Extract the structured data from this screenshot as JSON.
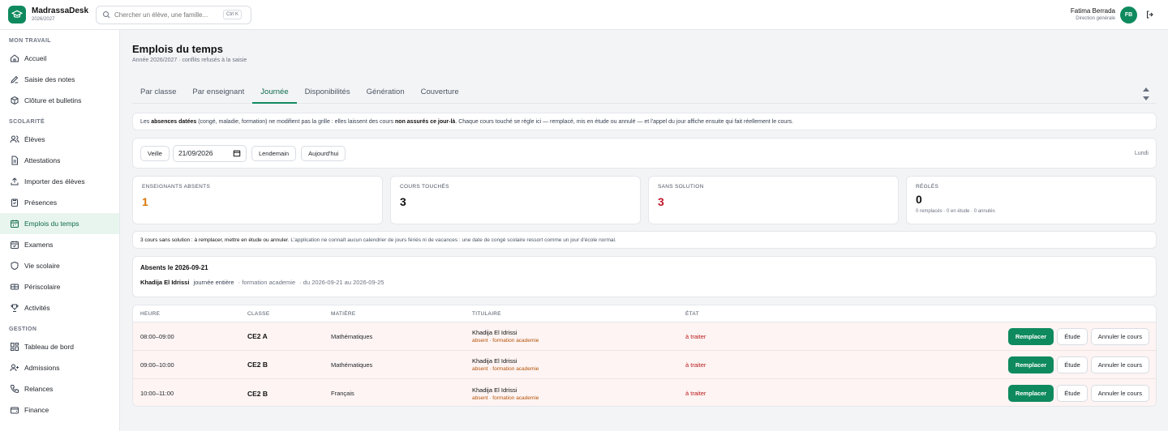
{
  "app": {
    "name": "MadrassaDesk",
    "year": "2026/2027"
  },
  "search": {
    "placeholder": "Chercher un élève, une famille...",
    "shortcut": "Ctrl K"
  },
  "user": {
    "name": "Fatima Berrada",
    "role": "Direction générale",
    "initials": "FB"
  },
  "sidebar": {
    "sections": [
      {
        "label": "MON TRAVAIL",
        "items": [
          {
            "label": "Accueil",
            "icon": "home-icon"
          },
          {
            "label": "Saisie des notes",
            "icon": "pen-icon"
          },
          {
            "label": "Clôture et bulletins",
            "icon": "box-icon"
          }
        ]
      },
      {
        "label": "SCOLARITÉ",
        "items": [
          {
            "label": "Élèves",
            "icon": "users-icon"
          },
          {
            "label": "Attestations",
            "icon": "file-icon"
          },
          {
            "label": "Importer des élèves",
            "icon": "upload-icon"
          },
          {
            "label": "Présences",
            "icon": "clipboard-icon"
          },
          {
            "label": "Emplois du temps",
            "icon": "calendar-icon",
            "active": true
          },
          {
            "label": "Examens",
            "icon": "exam-icon"
          },
          {
            "label": "Vie scolaire",
            "icon": "shield-icon"
          },
          {
            "label": "Périscolaire",
            "icon": "ticket-icon"
          },
          {
            "label": "Activités",
            "icon": "trophy-icon"
          }
        ]
      },
      {
        "label": "GESTION",
        "items": [
          {
            "label": "Tableau de bord",
            "icon": "dashboard-icon"
          },
          {
            "label": "Admissions",
            "icon": "user-plus-icon"
          },
          {
            "label": "Relances",
            "icon": "phone-icon"
          },
          {
            "label": "Finance",
            "icon": "wallet-icon"
          }
        ]
      }
    ]
  },
  "page": {
    "title": "Emplois du temps",
    "subtitle": "Année 2026/2027 · conflits refusés à la saisie"
  },
  "tabs": [
    "Par classe",
    "Par enseignant",
    "Journée",
    "Disponibilités",
    "Génération",
    "Couverture"
  ],
  "active_tab": "Journée",
  "notice": {
    "p1": "Les ",
    "b1": "absences datées",
    "p2": " (congé, maladie, formation) ne modifient pas la grille : elles laissent des cours ",
    "b2": "non assurés ce jour-là",
    "p3": ". Chaque cours touché se règle ici — remplacé, mis en étude ou annulé — et l'appel du jour affiche ensuite qui fait réellement le cours."
  },
  "datebar": {
    "prev": "Veille",
    "date": "21/09/2026",
    "next": "Lendemain",
    "today": "Aujourd'hui",
    "day": "Lundi"
  },
  "stats": [
    {
      "label": "ENSEIGNANTS ABSENTS",
      "value": "1",
      "color": "#d97706",
      "note": ""
    },
    {
      "label": "COURS TOUCHÉS",
      "value": "3",
      "color": "#111111",
      "note": ""
    },
    {
      "label": "SANS SOLUTION",
      "value": "3",
      "color": "#c2182b",
      "note": ""
    },
    {
      "label": "RÉGLÉS",
      "value": "0",
      "color": "#111111",
      "note": "0 remplacés · 0 en étude · 0 annulés"
    }
  ],
  "info": {
    "b1": "3 cours sans solution : à remplacer, mettre en étude ou annuler",
    "p1": ". L'application ne connaît aucun calendrier de jours fériés ni de vacances : une date de congé scolaire ressort comme un jour d'école normal."
  },
  "absents": {
    "title": "Absents le 2026-09-21",
    "name": "Khadija El Idrissi",
    "duration": "journée entière",
    "reason": "· formation academie",
    "range": "· du 2026-09-21 au 2026-09-25"
  },
  "table": {
    "headers": {
      "heure": "HEURE",
      "classe": "CLASSE",
      "matiere": "MATIÈRE",
      "titulaire": "TITULAIRE",
      "etat": "ÉTAT"
    },
    "rows": [
      {
        "heure": "08:00–09:00",
        "classe": "CE2 A",
        "matiere": "Mathématiques",
        "titulaire": "Khadija El Idrissi",
        "titulaire_sub": "absent · formation academie",
        "etat": "à traiter"
      },
      {
        "heure": "09:00–10:00",
        "classe": "CE2 B",
        "matiere": "Mathématiques",
        "titulaire": "Khadija El Idrissi",
        "titulaire_sub": "absent · formation academie",
        "etat": "à traiter"
      },
      {
        "heure": "10:00–11:00",
        "classe": "CE2 B",
        "matiere": "Français",
        "titulaire": "Khadija El Idrissi",
        "titulaire_sub": "absent · formation academie",
        "etat": "à traiter"
      }
    ],
    "actions": {
      "replace": "Remplacer",
      "study": "Étude",
      "cancel": "Annuler le cours"
    }
  },
  "colors": {
    "brand": "#0f8a5f",
    "danger": "#c2182b",
    "warning": "#d97706"
  }
}
